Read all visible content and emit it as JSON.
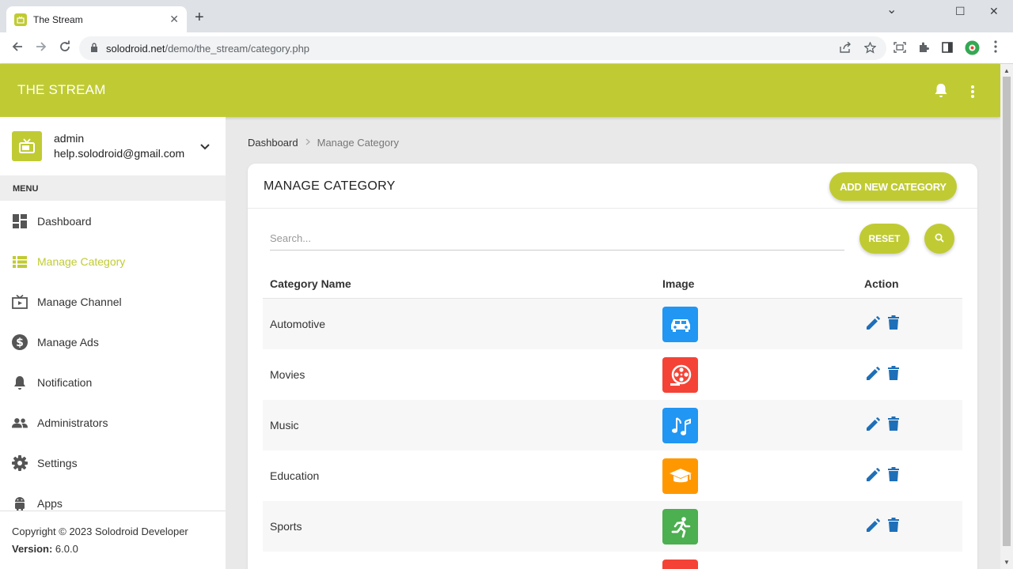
{
  "browser": {
    "tab_title": "The Stream",
    "tab_close": "✕",
    "new_tab": "+",
    "url_host": "solodroid.net",
    "url_path": "/demo/the_stream/category.php",
    "win_min": "⌄",
    "win_restore": "☐",
    "win_close": "✕"
  },
  "topbar": {
    "brand": "THE STREAM",
    "accent_color": "#c0cb33"
  },
  "user": {
    "name": "admin",
    "email": "help.solodroid@gmail.com"
  },
  "sidebar": {
    "menu_heading": "MENU",
    "items": [
      {
        "label": "Dashboard",
        "icon": "dashboard-icon",
        "active": false
      },
      {
        "label": "Manage Category",
        "icon": "list-icon",
        "active": true
      },
      {
        "label": "Manage Channel",
        "icon": "tv-icon",
        "active": false
      },
      {
        "label": "Manage Ads",
        "icon": "dollar-icon",
        "active": false
      },
      {
        "label": "Notification",
        "icon": "bell-icon",
        "active": false
      },
      {
        "label": "Administrators",
        "icon": "people-icon",
        "active": false
      },
      {
        "label": "Settings",
        "icon": "gear-icon",
        "active": false
      },
      {
        "label": "Apps",
        "icon": "android-icon",
        "active": false
      }
    ],
    "copyright": "Copyright © 2023 Solodroid Developer",
    "version_label": "Version:",
    "version_value": "6.0.0"
  },
  "breadcrumb": {
    "home": "Dashboard",
    "current": "Manage Category"
  },
  "card": {
    "title": "MANAGE CATEGORY",
    "add_button": "ADD NEW CATEGORY",
    "search_placeholder": "Search...",
    "reset_button": "RESET"
  },
  "table": {
    "columns": [
      "Category Name",
      "Image",
      "Action"
    ],
    "rows": [
      {
        "name": "Automotive",
        "icon": "car-icon",
        "color": "#2196f3"
      },
      {
        "name": "Movies",
        "icon": "film-reel-icon",
        "color": "#f44336"
      },
      {
        "name": "Music",
        "icon": "music-note-icon",
        "color": "#2196f3"
      },
      {
        "name": "Education",
        "icon": "graduation-cap-icon",
        "color": "#ff9800"
      },
      {
        "name": "Sports",
        "icon": "running-person-icon",
        "color": "#4caf50"
      }
    ],
    "action_color": "#1e6fb8"
  }
}
